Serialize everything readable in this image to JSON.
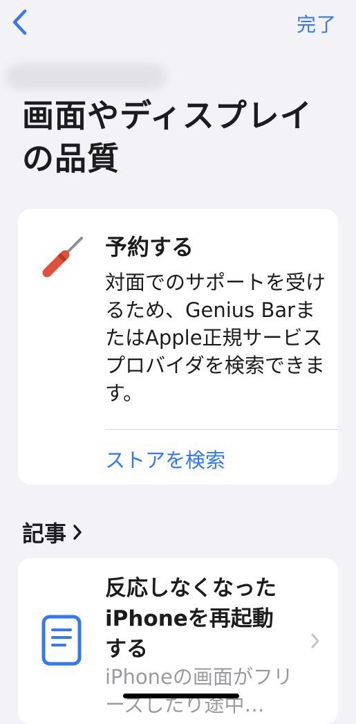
{
  "nav": {
    "done_label": "完了",
    "back_icon": "chevron-left-icon"
  },
  "page": {
    "title": "画面やディスプレイの品質"
  },
  "appointment_card": {
    "icon": "screwdriver-icon",
    "title": "予約する",
    "body": "対面でのサポートを受けるため、Genius BarまたはApple正規サービスプロバイダを検索できます。",
    "link_label": "ストアを検索"
  },
  "articles": {
    "section_title": "記事",
    "items": [
      {
        "icon": "document-icon",
        "title": "反応しなくなったiPhoneを再起動する",
        "description": "iPhoneの画面がフリーズしたり途中…"
      }
    ]
  },
  "colors": {
    "accent": "#3478f6",
    "background": "#f2f2f7",
    "card": "#ffffff",
    "tool_handle": "#e0503a"
  }
}
